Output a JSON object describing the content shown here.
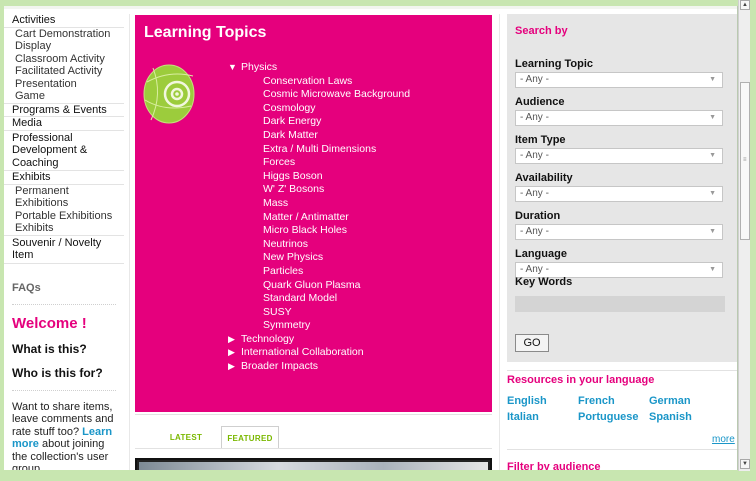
{
  "sidebar": {
    "items": [
      {
        "label": "Activities",
        "type": "main"
      },
      {
        "label": "Cart Demonstration Display",
        "type": "sub"
      },
      {
        "label": "Classroom Activity",
        "type": "sub"
      },
      {
        "label": "Facilitated Activity Presentation",
        "type": "sub"
      },
      {
        "label": "Game",
        "type": "sub",
        "last": true
      },
      {
        "label": "Programs & Events",
        "type": "main"
      },
      {
        "label": "Media",
        "type": "main"
      },
      {
        "label": "Professional Development & Coaching",
        "type": "main"
      },
      {
        "label": "Exhibits",
        "type": "main"
      },
      {
        "label": "Permanent Exhibitions",
        "type": "sub"
      },
      {
        "label": "Portable Exhibitions",
        "type": "sub"
      },
      {
        "label": "Exhibits",
        "type": "sub",
        "last": true
      },
      {
        "label": "Souvenir / Novelty Item",
        "type": "main"
      }
    ],
    "faqs": "FAQs",
    "welcome": "Welcome !",
    "what": "What is this?",
    "who": "Who is this for?",
    "share_pre": "Want to share items, leave comments and rate stuff too?",
    "share_link": "Learn more",
    "share_post": "about joining the collection's user group."
  },
  "panel": {
    "title": "Learning Topics",
    "tree": [
      {
        "label": "Physics",
        "expanded": true,
        "children": [
          "Conservation Laws",
          "Cosmic Microwave Background",
          "Cosmology",
          "Dark Energy",
          "Dark Matter",
          "Extra / Multi Dimensions",
          "Forces",
          "Higgs Boson",
          "W' Z' Bosons",
          "Mass",
          "Matter / Antimatter",
          "Micro Black Holes",
          "Neutrinos",
          "New Physics",
          "Particles",
          "Quark Gluon Plasma",
          "Standard Model",
          "SUSY",
          "Symmetry"
        ]
      },
      {
        "label": "Technology",
        "expanded": false,
        "children": []
      },
      {
        "label": "International Collaboration",
        "expanded": false,
        "children": []
      },
      {
        "label": "Broader Impacts",
        "expanded": false,
        "children": []
      }
    ]
  },
  "tabs": {
    "latest": "LATEST",
    "featured": "FEATURED"
  },
  "search": {
    "title": "Search by",
    "filters": [
      {
        "label": "Learning Topic",
        "value": "- Any -"
      },
      {
        "label": "Audience",
        "value": "- Any -"
      },
      {
        "label": "Item Type",
        "value": "- Any -"
      },
      {
        "label": "Availability",
        "value": "- Any -"
      },
      {
        "label": "Duration",
        "value": "- Any -"
      },
      {
        "label": "Language",
        "value": "- Any -"
      }
    ],
    "keywords_label": "Key Words",
    "keywords_value": "",
    "go": "GO"
  },
  "resources": {
    "title": "Resources in your language",
    "languages": [
      "English",
      "French",
      "German",
      "Italian",
      "Portuguese",
      "Spanish"
    ],
    "more": "more"
  },
  "audience_title": "Filter by audience",
  "colors": {
    "accent": "#e5007d",
    "link": "#1a96c8",
    "green": "#7ab800"
  },
  "icons": {
    "expanded": "triangle-down-icon",
    "collapsed": "triangle-right-icon",
    "logo": "particle-logo"
  }
}
